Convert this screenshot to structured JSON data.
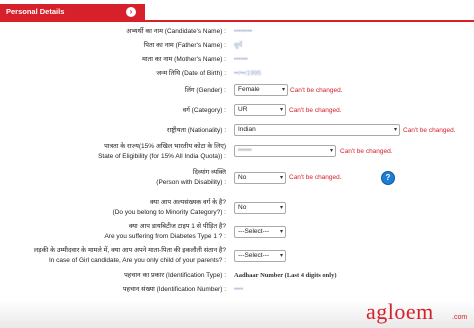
{
  "section": {
    "title": "Personal Details",
    "toggle_icon": "chevron-right-icon"
  },
  "fields": {
    "candidate_name": {
      "label": "अभ्यर्थी का नाम (Candidate's Name) :",
      "value": "••••••••"
    },
    "father_name": {
      "label": "पिता का नाम (Father's Name) :",
      "value": "सुर्ये"
    },
    "mother_name": {
      "label": "माता का नाम (Mother's Name) :",
      "value": "••••••"
    },
    "dob": {
      "label": "जन्म तिथि (Date of Birth) :",
      "value": "••/••/1995"
    },
    "gender": {
      "label": "लिंग (Gender) :",
      "value": "Female",
      "note": "Can't be changed."
    },
    "category": {
      "label": "वर्ग (Category) :",
      "value": "UR",
      "note": "Can't be changed."
    },
    "nationality": {
      "label": "राष्ट्रीयता (Nationality) :",
      "value": "Indian",
      "note": "Can't be changed."
    },
    "state_eligibility": {
      "label_hi": "पात्रता के राज्य(15% अखिल भारतीय कोटा के लिए)",
      "label_en": "State of Eligibility (for 15% All India Quota)) :",
      "value": "••••••",
      "note": "Can't be changed."
    },
    "disability": {
      "label_hi": "दिव्यांग व्यक्ति",
      "label_en": "(Person with Disability) :",
      "value": "No",
      "note": "Can't be changed."
    },
    "minority": {
      "label_hi": "क्या आप अल्पसंख्यक वर्ग के है?",
      "label_en": "(Do you belong to Minority Category?) :",
      "value": "No"
    },
    "diabetes": {
      "label_hi": "क्या आप डायबिटीज टाइप 1 से पीड़ित है?",
      "label_en": "Are you suffering from Diabetes Type 1 ? :",
      "value": "---Select---"
    },
    "only_child": {
      "label_hi": "लड़की के उम्मीदवार के मामले में, क्या आप अपने माता-पिता की इकलौती संतान है?",
      "label_en": "In case of Girl candidate, Are you only child of your parents? :",
      "value": "---Select---"
    },
    "id_type": {
      "label": "पहचान का प्रकार (Identification Type) :",
      "value": "Aadhaar Number (Last 4 digits only)"
    },
    "id_number": {
      "label": "पहचान संख्या (Identification Number) :",
      "value": "••••"
    }
  },
  "colors": {
    "accent": "#d6202a",
    "help": "#1e7ed6"
  },
  "logo": {
    "text": "agloem",
    "suffix": ".com"
  }
}
